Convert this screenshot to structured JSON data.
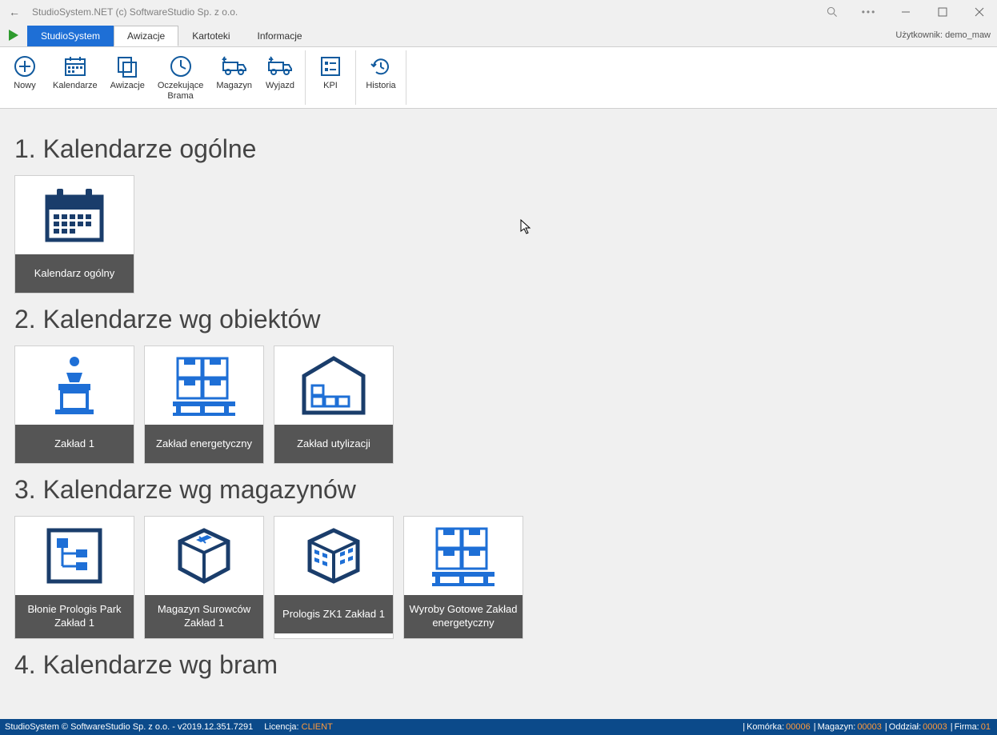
{
  "window": {
    "title": "StudioSystem.NET (c) SoftwareStudio Sp. z o.o."
  },
  "user_label": "Użytkownik: demo_maw",
  "menu": {
    "primary": "StudioSystem",
    "tabs": [
      "Awizacje",
      "Kartoteki",
      "Informacje"
    ],
    "active": "Awizacje"
  },
  "ribbon": {
    "group1": [
      {
        "label": "Nowy",
        "icon": "plus-circle"
      },
      {
        "label": "Kalendarze",
        "icon": "calendar"
      },
      {
        "label": "Awizacje",
        "icon": "copy"
      },
      {
        "label": "Oczekujące\nBrama",
        "icon": "clock"
      },
      {
        "label": "Magazyn",
        "icon": "truck-in"
      },
      {
        "label": "Wyjazd",
        "icon": "truck-out"
      }
    ],
    "group2": [
      {
        "label": "KPI",
        "icon": "kpi"
      }
    ],
    "group3": [
      {
        "label": "Historia",
        "icon": "history"
      }
    ]
  },
  "sections": [
    {
      "title": "1. Kalendarze ogólne",
      "tiles": [
        {
          "label": "Kalendarz ogólny",
          "icon": "calendar-big"
        }
      ]
    },
    {
      "title": "2. Kalendarze wg obiektów",
      "tiles": [
        {
          "label": "Zakład 1",
          "icon": "podium"
        },
        {
          "label": "Zakład energetyczny",
          "icon": "pallet"
        },
        {
          "label": "Zakład utylizacji",
          "icon": "warehouse"
        }
      ]
    },
    {
      "title": "3. Kalendarze wg magazynów",
      "tiles": [
        {
          "label": "Błonie Prologis Park Zakład 1",
          "icon": "flowchart"
        },
        {
          "label": "Magazyn Surowców Zakład 1",
          "icon": "box3d"
        },
        {
          "label": "Prologis ZK1 Zakład 1",
          "icon": "building"
        },
        {
          "label": "Wyroby Gotowe Zakład energetyczny",
          "icon": "pallet"
        }
      ]
    },
    {
      "title": "4. Kalendarze wg bram",
      "tiles": []
    }
  ],
  "status": {
    "left_app": "StudioSystem © SoftwareStudio Sp. z o.o. - v2019.12.351.7291",
    "license_label": "Licencja:",
    "license_value": "CLIENT",
    "cells": [
      {
        "label": "Komórka:",
        "value": "00006"
      },
      {
        "label": "Magazyn:",
        "value": "00003"
      },
      {
        "label": "Oddział:",
        "value": "00003"
      },
      {
        "label": "Firma:",
        "value": "01"
      }
    ]
  }
}
